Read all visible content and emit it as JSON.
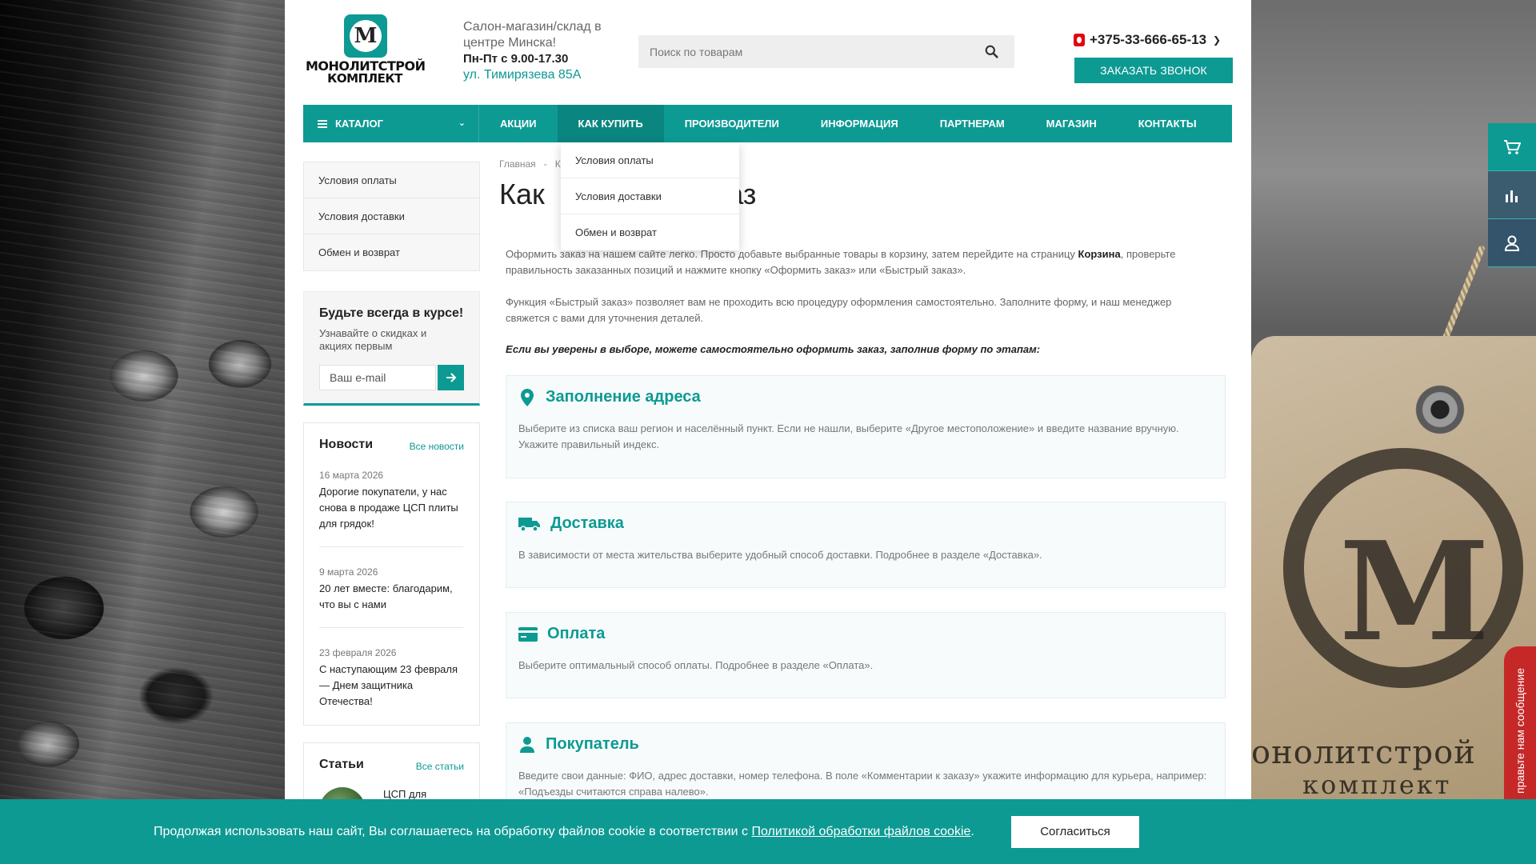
{
  "logo": {
    "mark": "М",
    "line1": "МОНОЛИТСТРОЙ",
    "line2": "КОМПЛЕКТ"
  },
  "header": {
    "info_line1": "Салон-магазин/склад в",
    "info_line2": "центре Минска!",
    "hours": "Пн-Пт с 9.00-17.30",
    "address": "ул. Тимирязева 85А",
    "search_placeholder": "Поиск по товарам",
    "phone": "+375-33-666-65-13",
    "callback_label": "Заказать звонок"
  },
  "nav": {
    "catalog_label": "КАТАЛОГ",
    "items": [
      "АКЦИИ",
      "КАК КУПИТЬ",
      "ПРОИЗВОДИТЕЛИ",
      "ИНФОРМАЦИЯ",
      "ПАРТНЕРАМ",
      "МАГАЗИН",
      "КОНТАКТЫ"
    ],
    "active": "КАК КУПИТЬ"
  },
  "dropdown": {
    "items": [
      "Условия оплаты",
      "Условия доставки",
      "Обмен и возврат"
    ]
  },
  "sidebar": {
    "menu": [
      "Условия оплаты",
      "Условия доставки",
      "Обмен и возврат"
    ],
    "subscribe": {
      "title": "Будьте всегда в курсе!",
      "subtitle": "Узнавайте о скидках и акциях первым",
      "placeholder": "Ваш e-mail"
    },
    "news": {
      "title": "Новости",
      "all_label": "Все новости",
      "items": [
        {
          "date": "16 марта 2026",
          "text": "Дорогие покупатели, у нас снова в продаже ЦСП плиты для грядок!"
        },
        {
          "date": "9 марта 2026",
          "text": "20 лет вместе: благодарим, что вы с нами"
        },
        {
          "date": "23 февраля 2026",
          "text": "С наступающим 23 февраля — Днем защитника Отечества!"
        }
      ]
    },
    "articles": {
      "title": "Статьи",
      "all_label": "Все статьи",
      "first_item": "ЦСП для"
    }
  },
  "main": {
    "breadcrumb_home": "Главная",
    "breadcrumb_sep": "-",
    "breadcrumb_next": "К...",
    "title_left": "Как",
    "title_right": "каз",
    "p1_before": "Оформить заказ на нашем сайте легко. Просто добавьте выбранные товары в корзину, затем перейдите на страницу ",
    "p1_bold": "Корзина",
    "p1_after": ", проверьте правильность заказанных позиций и нажмите кнопку «Оформить заказ» или «Быстрый заказ».",
    "p2": "Функция «Быстрый заказ» позволяет вам не проходить всю процедуру оформления самостоятельно. Заполните форму, и наш менеджер свяжется с вами для уточнения деталей.",
    "p3": "Если вы уверены в выборе, можете самостоятельно оформить заказ, заполнив форму по этапам:",
    "steps": [
      {
        "icon": "map-pin-icon",
        "title": "Заполнение адреса",
        "text": "Выберите из списка ваш регион и населённый пункт. Если не нашли, выберите «Другое местоположение» и введите название вручную. Укажите правильный индекс."
      },
      {
        "icon": "truck-icon",
        "title": "Доставка",
        "text": "В зависимости от места жительства выберите удобный способ доставки. Подробнее в разделе «Доставка»."
      },
      {
        "icon": "credit-card-icon",
        "title": "Оплата",
        "text": "Выберите оптимальный способ оплаты. Подробнее в разделе «Оплата»."
      },
      {
        "icon": "user-icon",
        "title": "Покупатель",
        "text": "Введите свои данные: ФИО, адрес доставки, номер телефона. В поле «Комментарии к заказу» укажите информацию для курьера, например: «Подъезды считаются справа налево»."
      }
    ]
  },
  "float_bar": {
    "icons": [
      "cart-icon",
      "compare-icon",
      "account-icon"
    ]
  },
  "message_tab": {
    "label": "правьте нам сообщение"
  },
  "cookie": {
    "text": "Продолжая использовать наш сайт, Вы соглашаетесь на обработку файлов cookie в соответствии с ",
    "link": "Политикой обработки файлов cookie",
    "end": ".",
    "button": "Согласиться"
  },
  "colors": {
    "accent": "#0d9a93",
    "accent_dark": "#0a857f",
    "message_tab": "#c62828"
  }
}
